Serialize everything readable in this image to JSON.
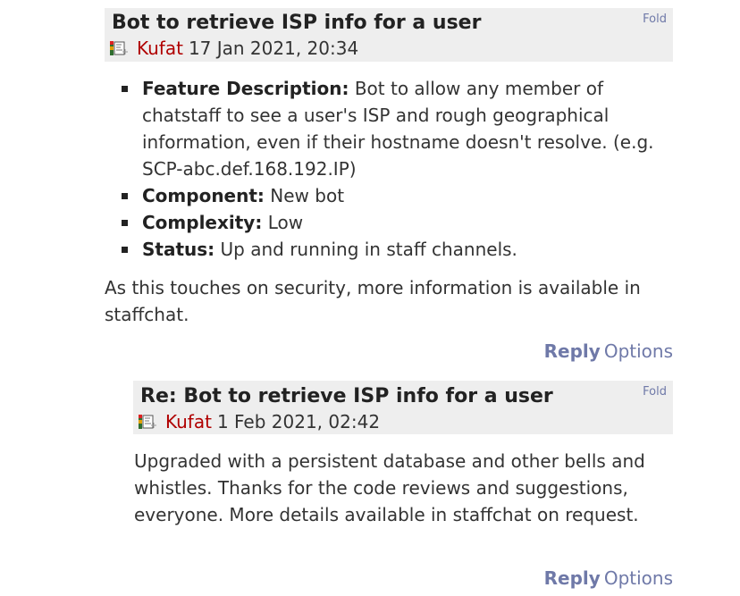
{
  "posts": [
    {
      "title": "Bot to retrieve ISP info for a user",
      "fold": "Fold",
      "author": "Kufat",
      "date": "17 Jan 2021, 20:34",
      "features": [
        {
          "label": "Feature Description:",
          "value": " Bot to allow any member of chatstaff to see a user's ISP and rough geographical information, even if their hostname doesn't resolve. (e.g. SCP-abc.def.168.192.IP)"
        },
        {
          "label": "Component:",
          "value": " New bot"
        },
        {
          "label": "Complexity:",
          "value": " Low"
        },
        {
          "label": "Status:",
          "value": " Up and running in staff channels."
        }
      ],
      "body": "As this touches on security, more information is available in staffchat.",
      "reply": "Reply",
      "options": "Options"
    },
    {
      "title": "Re: Bot to retrieve ISP info for a user",
      "fold": "Fold",
      "author": "Kufat",
      "date": "1 Feb 2021, 02:42",
      "body": "Upgraded with a persistent database and other bells and whistles. Thanks for the code reviews and suggestions, everyone. More details available in staffchat on request.",
      "reply": "Reply",
      "options": "Options"
    }
  ],
  "colors": {
    "header_bg": "#eeeeee",
    "link": "#6f79a8",
    "author": "#b00000"
  },
  "icons": {
    "user_flag": "user-flag-icon"
  }
}
